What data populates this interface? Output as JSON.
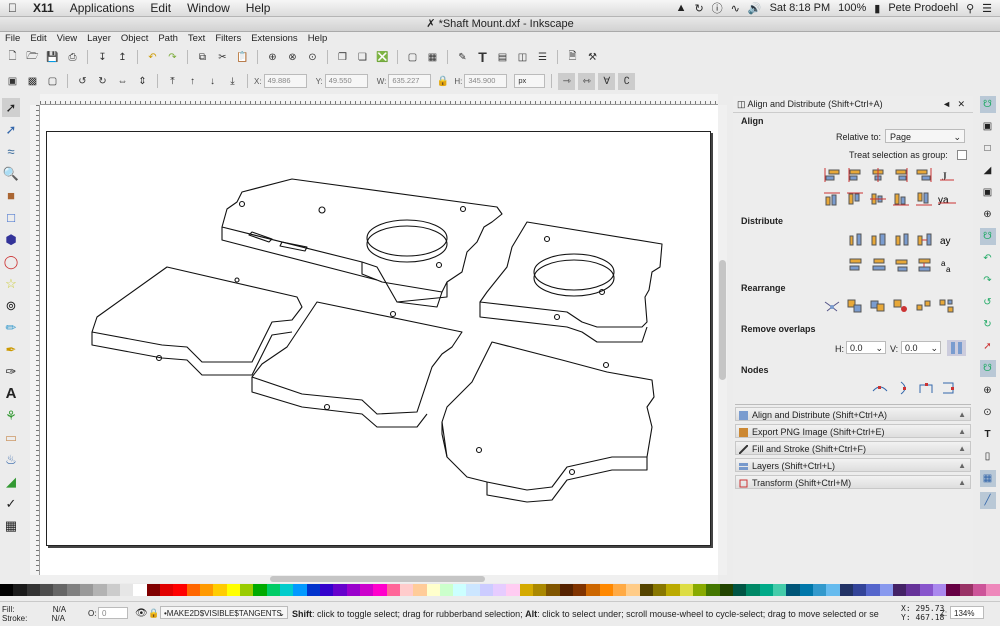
{
  "menubar": {
    "app": "X11",
    "items": [
      "Applications",
      "Edit",
      "Window",
      "Help"
    ],
    "battery": "100%",
    "clock": "Sat 8:18 PM",
    "user": "Pete Prodoehl"
  },
  "window": {
    "title": "*Shaft Mount.dxf - Inkscape"
  },
  "app_menu": [
    "File",
    "Edit",
    "View",
    "Layer",
    "Object",
    "Path",
    "Text",
    "Filters",
    "Extensions",
    "Help"
  ],
  "controls": {
    "x_label": "X:",
    "x_value": "49.886",
    "y_label": "Y:",
    "y_value": "49.550",
    "w_label": "W:",
    "w_value": "635.227",
    "h_label": "H:",
    "h_value": "345.900",
    "unit": "px"
  },
  "dock": {
    "title": "Align and Distribute (Shift+Ctrl+A)",
    "align_heading": "Align",
    "relative_to_label": "Relative to:",
    "relative_to_value": "Page",
    "treat_selection_label": "Treat selection as group:",
    "distribute_heading": "Distribute",
    "rearrange_heading": "Rearrange",
    "remove_overlaps_heading": "Remove overlaps",
    "h_label": "H:",
    "h_value": "0.0",
    "v_label": "V:",
    "v_value": "0.0",
    "nodes_heading": "Nodes",
    "panels": [
      "Align and Distribute (Shift+Ctrl+A)",
      "Export PNG Image (Shift+Ctrl+E)",
      "Fill and Stroke (Shift+Ctrl+F)",
      "Layers (Shift+Ctrl+L)",
      "Transform (Shift+Ctrl+M)"
    ]
  },
  "status": {
    "fill_label": "Fill:",
    "fill_value": "N/A",
    "stroke_label": "Stroke:",
    "stroke_value": "N/A",
    "opacity_label": "O:",
    "opacity_value": "0",
    "layer": "•MAKE2D$VISIBLE$TANGENTS",
    "message_bold1": "Shift",
    "message1": ": click to toggle select; drag for rubberband selection; ",
    "message_bold2": "Alt",
    "message2": ": click to select under; scroll mouse-wheel to cycle-select; drag to move selected or se",
    "x_label": "X:",
    "x_value": "295.73",
    "y_label": "Y:",
    "y_value": "467.18",
    "zoom_label": "Z:",
    "zoom_value": "134%"
  },
  "palette_colors": [
    "#000000",
    "#1a1a1a",
    "#333",
    "#4d4d4d",
    "#666",
    "#808080",
    "#999",
    "#b3b3b3",
    "#ccc",
    "#e6e6e6",
    "#fff",
    "#800000",
    "#e00000",
    "#ff0000",
    "#ff6600",
    "#ff9900",
    "#ffcc00",
    "#ffff00",
    "#99cc00",
    "#00aa00",
    "#00cc66",
    "#00cccc",
    "#0099ff",
    "#0033cc",
    "#3300cc",
    "#6600cc",
    "#9900cc",
    "#cc00cc",
    "#ff00cc",
    "#ff6699",
    "#ffcccc",
    "#ffcc99",
    "#ffffcc",
    "#ccffcc",
    "#ccffff",
    "#cce6ff",
    "#ccccff",
    "#e6ccff",
    "#ffccf2",
    "#d4aa00",
    "#aa8800",
    "#805500",
    "#552200",
    "#803300",
    "#cc6600",
    "#ff8800",
    "#ffaa44",
    "#ffcc88",
    "#554400",
    "#887700",
    "#bbaa00",
    "#dddd44",
    "#88aa00",
    "#447700",
    "#224400",
    "#005544",
    "#008866",
    "#00aa88",
    "#44ccaa",
    "#005577",
    "#0077aa",
    "#3399cc",
    "#66bbee",
    "#223366",
    "#334499",
    "#5566cc",
    "#8899ee",
    "#442266",
    "#663399",
    "#8855cc",
    "#aa88ee",
    "#660044",
    "#993366",
    "#cc5599",
    "#ee88bb"
  ]
}
